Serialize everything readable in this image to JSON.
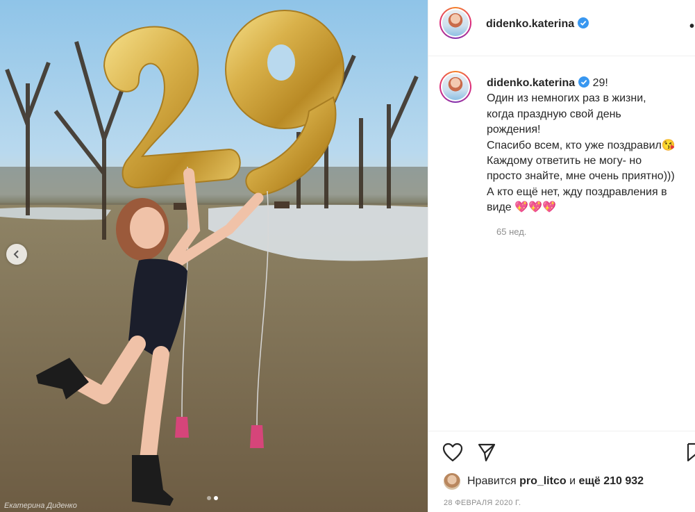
{
  "photo": {
    "watermark": "Екатерина Диденко",
    "dots_count": 2,
    "active_dot": 1
  },
  "header": {
    "username": "didenko.katerina",
    "verified": true,
    "more_label": "•"
  },
  "caption": {
    "username": "didenko.katerina",
    "lines": [
      "29!",
      "Один из немногих раз в жизни,",
      "когда праздную свой день",
      "рождения!",
      "Спасибо всем, кто уже поздравил😘",
      "Каждому ответить не могу- но",
      "просто знайте, мне очень приятно)))",
      "А кто ещё нет, жду поздравления в",
      "виде 💖💖💖"
    ],
    "age": "65 нед."
  },
  "likes": {
    "prefix": "Нравится",
    "liker": "pro_litco",
    "middle": "и",
    "others": "ещё 210 932"
  },
  "date": "28 ФЕВРАЛЯ 2020 Г.",
  "colors": {
    "verified": "#3897f0",
    "meta_text": "#8e8e8e",
    "balloon_gold": "#d4a93a"
  }
}
